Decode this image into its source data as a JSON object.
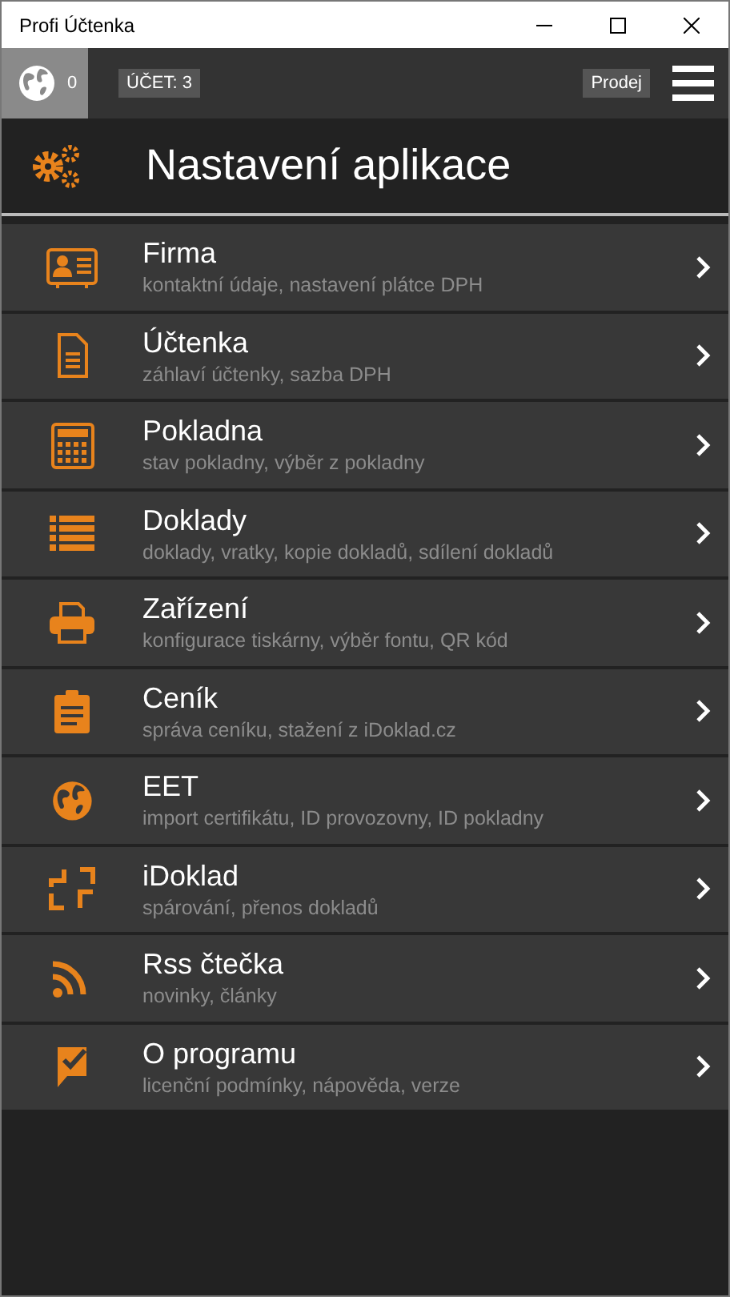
{
  "window": {
    "title": "Profi Účtenka"
  },
  "toolbar": {
    "online_count": "0",
    "account": "ÚČET: 3",
    "mode_button": "Prodej"
  },
  "header": {
    "title": "Nastavení aplikace"
  },
  "items": [
    {
      "title": "Firma",
      "subtitle": "kontaktní údaje, nastavení plátce DPH"
    },
    {
      "title": "Účtenka",
      "subtitle": "záhlaví účtenky, sazba DPH"
    },
    {
      "title": "Pokladna",
      "subtitle": "stav pokladny, výběr z pokladny"
    },
    {
      "title": "Doklady",
      "subtitle": "doklady, vratky, kopie dokladů, sdílení dokladů"
    },
    {
      "title": "Zařízení",
      "subtitle": "konfigurace tiskárny, výběr fontu, QR kód"
    },
    {
      "title": "Ceník",
      "subtitle": "správa ceníku, stažení z iDoklad.cz"
    },
    {
      "title": "EET",
      "subtitle": "import certifikátu, ID provozovny, ID pokladny"
    },
    {
      "title": "iDoklad",
      "subtitle": "spárování, přenos dokladů"
    },
    {
      "title": "Rss čtečka",
      "subtitle": "novinky, články"
    },
    {
      "title": "O programu",
      "subtitle": "licenční podmínky, nápověda, verze"
    }
  ]
}
